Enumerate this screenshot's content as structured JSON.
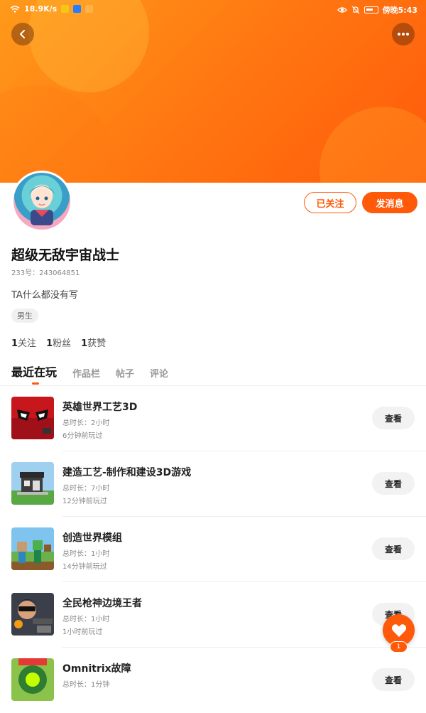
{
  "status_bar": {
    "net_speed": "18.9K/s",
    "time": "傍晚5:43"
  },
  "profile": {
    "follow_state_label": "已关注",
    "message_label": "发消息",
    "username": "超级无敌宇宙战士",
    "uid_label": "233号：",
    "uid_value": "243064851",
    "bio": "TA什么都没有写",
    "gender": "男生",
    "stats": [
      {
        "count": "1",
        "label": "关注"
      },
      {
        "count": "1",
        "label": "粉丝"
      },
      {
        "count": "1",
        "label": "获赞"
      }
    ]
  },
  "tabs": [
    "最近在玩",
    "作品栏",
    "帖子",
    "评论"
  ],
  "games": [
    {
      "title": "英雄世界工艺3D",
      "duration": "总时长：2小时",
      "last_played": "6分钟前玩过",
      "action": "查看"
    },
    {
      "title": "建造工艺-制作和建设3D游戏",
      "duration": "总时长：7小时",
      "last_played": "12分钟前玩过",
      "action": "查看"
    },
    {
      "title": "创造世界模组",
      "duration": "总时长：1小时",
      "last_played": "14分钟前玩过",
      "action": "查看"
    },
    {
      "title": "全民枪神边境王者",
      "duration": "总时长：1小时",
      "last_played": "1小时前玩过",
      "action": "查看"
    },
    {
      "title": "Omnitrix故障",
      "duration": "总时长：1分钟",
      "last_played": "",
      "action": "查看"
    }
  ],
  "favorite": {
    "count": "1"
  },
  "colors": {
    "accent": "#ff5a0a",
    "banner_start": "#ff9a1a",
    "banner_end": "#ff5a0a"
  }
}
